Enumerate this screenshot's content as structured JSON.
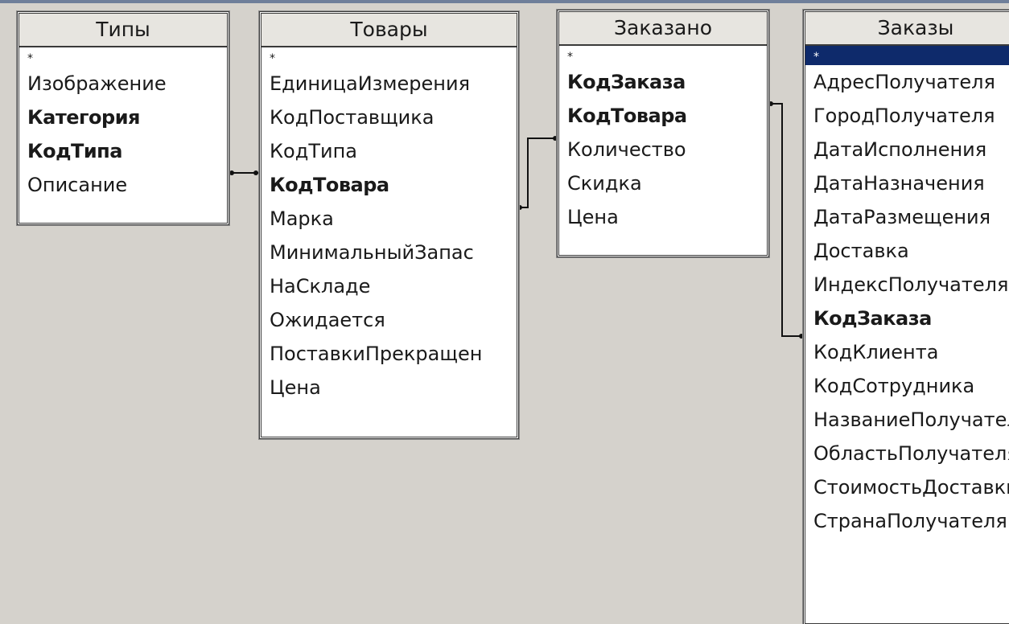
{
  "tables": [
    {
      "title": "Типы",
      "fields": [
        {
          "label": "*",
          "key": false
        },
        {
          "label": "Изображение",
          "key": false
        },
        {
          "label": "Категория",
          "key": true
        },
        {
          "label": "КодТипа",
          "key": true
        },
        {
          "label": "Описание",
          "key": false
        }
      ]
    },
    {
      "title": "Товары",
      "fields": [
        {
          "label": "*",
          "key": false
        },
        {
          "label": "ЕдиницаИзмерения",
          "key": false
        },
        {
          "label": "КодПоставщика",
          "key": false
        },
        {
          "label": "КодТипа",
          "key": false
        },
        {
          "label": "КодТовара",
          "key": true
        },
        {
          "label": "Марка",
          "key": false
        },
        {
          "label": "МинимальныйЗапас",
          "key": false
        },
        {
          "label": "НаСкладе",
          "key": false
        },
        {
          "label": "Ожидается",
          "key": false
        },
        {
          "label": "ПоставкиПрекращен",
          "key": false
        },
        {
          "label": "Цена",
          "key": false
        }
      ]
    },
    {
      "title": "Заказано",
      "fields": [
        {
          "label": "*",
          "key": false
        },
        {
          "label": "КодЗаказа",
          "key": true
        },
        {
          "label": "КодТовара",
          "key": true
        },
        {
          "label": "Количество",
          "key": false
        },
        {
          "label": "Скидка",
          "key": false
        },
        {
          "label": "Цена",
          "key": false
        }
      ]
    },
    {
      "title": "Заказы",
      "selected_field_index": 0,
      "fields": [
        {
          "label": "*",
          "key": false
        },
        {
          "label": "АдресПолучателя",
          "key": false
        },
        {
          "label": "ГородПолучателя",
          "key": false
        },
        {
          "label": "ДатаИсполнения",
          "key": false
        },
        {
          "label": "ДатаНазначения",
          "key": false
        },
        {
          "label": "ДатаРазмещения",
          "key": false
        },
        {
          "label": "Доставка",
          "key": false
        },
        {
          "label": "ИндексПолучателя",
          "key": false
        },
        {
          "label": "КодЗаказа",
          "key": true
        },
        {
          "label": "КодКлиента",
          "key": false
        },
        {
          "label": "КодСотрудника",
          "key": false
        },
        {
          "label": "НазваниеПолучателя",
          "key": false
        },
        {
          "label": "ОбластьПолучателя",
          "key": false
        },
        {
          "label": "СтоимостьДоставки",
          "key": false
        },
        {
          "label": "СтранаПолучателя",
          "key": false
        }
      ]
    }
  ],
  "relationships": [
    {
      "from_table": "Типы",
      "from_field": "КодТипа",
      "to_table": "Товары",
      "to_field": "КодТипа"
    },
    {
      "from_table": "Товары",
      "from_field": "КодТовара",
      "to_table": "Заказано",
      "to_field": "КодТовара"
    },
    {
      "from_table": "Заказано",
      "from_field": "КодЗаказа",
      "to_table": "Заказы",
      "to_field": "КодЗаказа"
    }
  ],
  "colors": {
    "background": "#d5d2cc",
    "selection": "#0e2a6b",
    "line": "#111111"
  }
}
